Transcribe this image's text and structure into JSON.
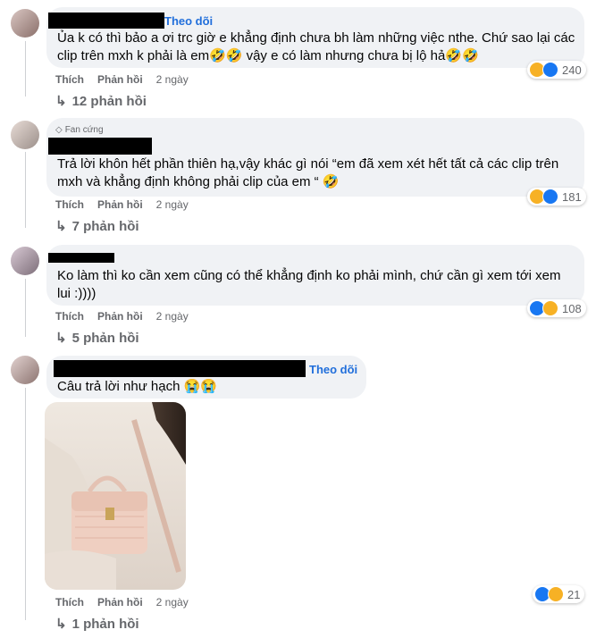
{
  "comments": [
    {
      "follow_label": "Theo dõi",
      "text": "Ủa k có thì bảo a ơi trc giờ e khẳng định chưa bh làm những việc nthe. Chứ sao lại các clip trên mxh k phải là em🤣🤣 vậy e có làm nhưng chưa bị lộ hả🤣🤣",
      "like_label": "Thích",
      "reply_label": "Phản hồi",
      "time": "2 ngày",
      "reaction_count": "240",
      "replies_label": "12 phản hồi"
    },
    {
      "badge_label": "Fan cứng",
      "text": "Trả lời khôn hết phần thiên hạ,vậy khác gì nói “em đã xem xét hết tất cả các clip trên mxh và khẳng định không phải clip của em “ 🤣",
      "like_label": "Thích",
      "reply_label": "Phản hồi",
      "time": "2 ngày",
      "reaction_count": "181",
      "replies_label": "7 phản hồi"
    },
    {
      "text": "Ko làm thì ko cần xem cũng có thể khẳng định ko phải mình, chứ cần gì xem tới xem lui :))))",
      "like_label": "Thích",
      "reply_label": "Phản hồi",
      "time": "2 ngày",
      "reaction_count": "108",
      "replies_label": "5 phản hồi"
    },
    {
      "follow_label": "Theo dõi",
      "text": "Câu trả lời như hạch 😭😭",
      "like_label": "Thích",
      "reply_label": "Phản hồi",
      "time": "2 ngày",
      "reaction_count": "21",
      "replies_label": "1 phản hồi"
    }
  ],
  "colors": {
    "link": "#216fdb",
    "bubble": "#f0f2f5",
    "meta": "#65676b",
    "like": "#1877f2",
    "haha": "#f7b125"
  }
}
